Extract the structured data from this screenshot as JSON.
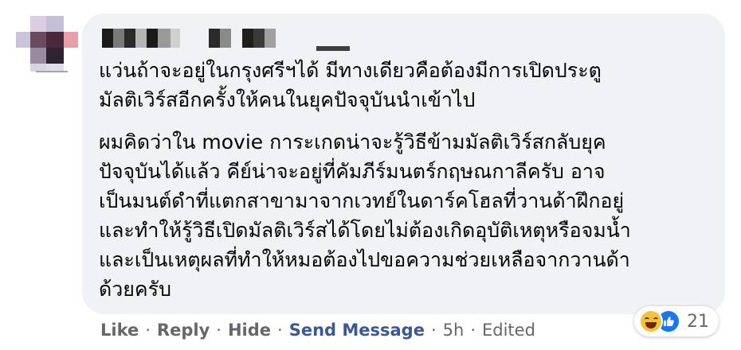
{
  "comment": {
    "paragraphs": [
      "แว่นถ้าจะอยู่ในกรุงศรีฯได้ มีทางเดียวคือต้องมีการเปิดประตู\nมัลติเวิร์สอีกครั้งให้คนในยุคปัจจุบันนำเข้าไป",
      "ผมคิดว่าใน movie การะเกดน่าจะรู้วิธีข้ามมัลติเวิร์สกลับยุค\nปัจจุบันได้แล้ว คีย์น่าจะอยู่ที่คัมภีร์มนตร์กฤษณกาลีครับ อาจ\nเป็นมนต์ดำที่แตกสาขามาจากเวทย์ในดาร์คโฮลที่วานด้าฝึกอยู่\nและทำให้รู้วิธีเปิดมัลติเวิร์สได้โดยไม่ต้องเกิดอุบัติเหตุหรือจมน้ำ\nและเป็นเหตุผลที่ทำให้หมอต้องไปขอความช่วยเหลือจากวานด้า\nด้วยครับ"
    ]
  },
  "reactions": {
    "icons": [
      "haha-icon",
      "like-icon"
    ],
    "count": "21"
  },
  "actions": {
    "like": "Like",
    "reply": "Reply",
    "hide": "Hide",
    "send_message": "Send Message",
    "separator": "·",
    "time": "5h",
    "edited": "Edited"
  },
  "colors": {
    "bubble": "#f0f2f5",
    "text": "#050505",
    "secondary": "#65676b",
    "link": "#385898",
    "like_blue": "#1877f2",
    "haha_yellow": "#f7c13a"
  }
}
